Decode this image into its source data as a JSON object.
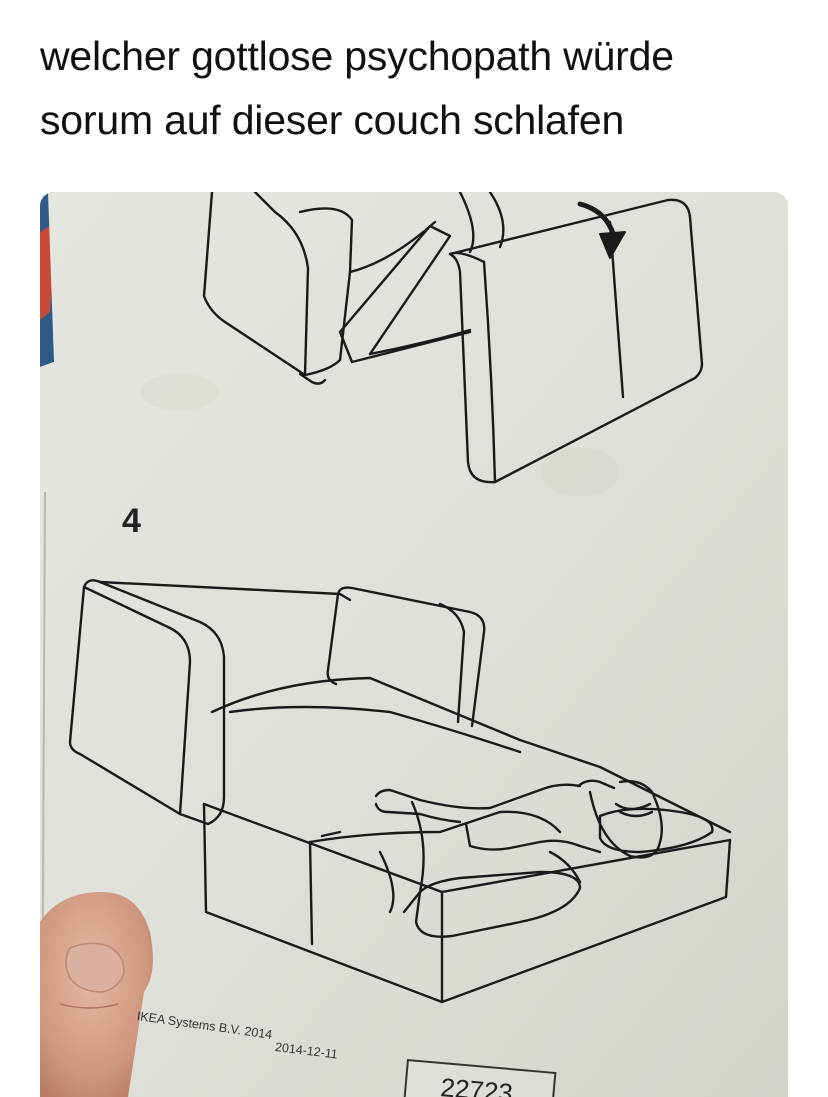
{
  "post": {
    "caption_line_1": "welcher gottlose psychopath würde",
    "caption_line_2": "sorum auf dieser couch schlafen"
  },
  "photo": {
    "subject": "IKEA sofa bed assembly instruction sheet held by hand",
    "step_number": "4",
    "footer_copyright": "IKEA Systems B.V. 2014",
    "footer_date": "2014-12-11",
    "footer_code": "22723"
  },
  "colors": {
    "paper": "#e4e4de",
    "line_art": "#1a1a1a",
    "skin": "#d9a88f",
    "background": "#ffffff"
  }
}
